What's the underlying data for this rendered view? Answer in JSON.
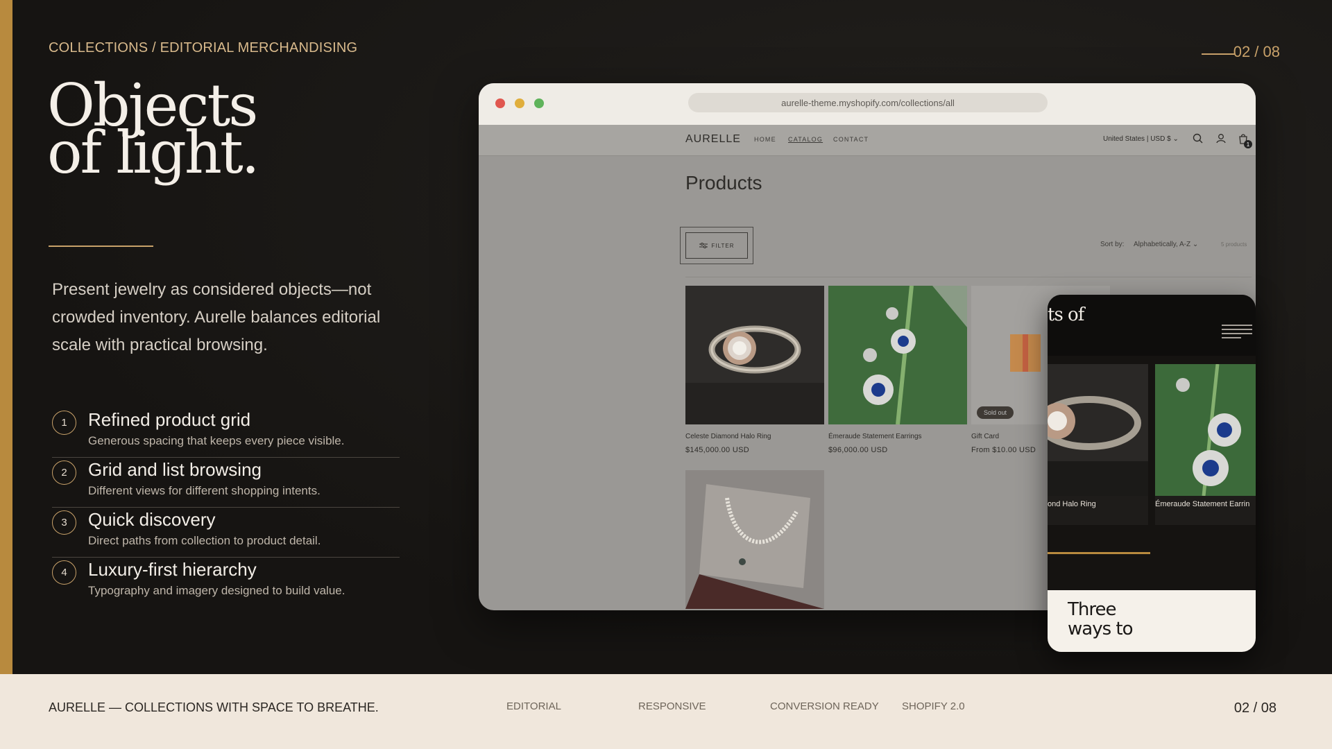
{
  "slide": {
    "kicker": "COLLECTIONS / EDITORIAL MERCHANDISING",
    "page_indicator": "02 / 08",
    "headline_line1": "Objects",
    "headline_line2": "of light.",
    "lede": "Present jewelry as considered objects—not crowded inventory. Aurelle balances editorial scale with practical browsing.",
    "features": [
      {
        "num": "1",
        "title": "Refined product grid",
        "desc": "Generous spacing that keeps every piece visible."
      },
      {
        "num": "2",
        "title": "Grid and list browsing",
        "desc": "Different views for different shopping intents."
      },
      {
        "num": "3",
        "title": "Quick discovery",
        "desc": "Direct paths from collection to product detail."
      },
      {
        "num": "4",
        "title": "Luxury-first hierarchy",
        "desc": "Typography and imagery designed to build value."
      }
    ]
  },
  "browser": {
    "url": "aurelle-theme.myshopify.com/collections/all",
    "shop": {
      "logo": "AURELLE",
      "nav": [
        "HOME",
        "CATALOG",
        "CONTACT"
      ],
      "region": "United States | USD $",
      "cart_count": "1",
      "page_title": "Products",
      "filter_label": "FILTER",
      "sort_label": "Sort by:",
      "sort_value": "Alphabetically, A-Z",
      "product_count": "5 products",
      "products": [
        {
          "name": "Celeste Diamond Halo Ring",
          "price": "$145,000.00 USD"
        },
        {
          "name": "Émeraude Statement Earrings",
          "price": "$96,000.00 USD"
        },
        {
          "name": "Gift Card",
          "price": "From $10.00 USD",
          "badge": "Sold out"
        },
        {
          "name": "",
          "price": ""
        }
      ]
    }
  },
  "phone": {
    "headline_fragment": "ts of",
    "card1_label": "ond Halo Ring",
    "card2_label": "Émeraude Statement Earrin",
    "white_text_line1": "Three",
    "white_text_line2": "ways to"
  },
  "footer": {
    "title": "AURELLE — COLLECTIONS WITH SPACE TO BREATHE.",
    "tags": [
      "EDITORIAL",
      "RESPONSIVE",
      "CONVERSION READY",
      "SHOPIFY 2.0"
    ],
    "page": "02 / 08"
  },
  "colors": {
    "accent_gold": "#b88a3e",
    "background": "#161412",
    "footer_bg": "#f0e7dc"
  }
}
